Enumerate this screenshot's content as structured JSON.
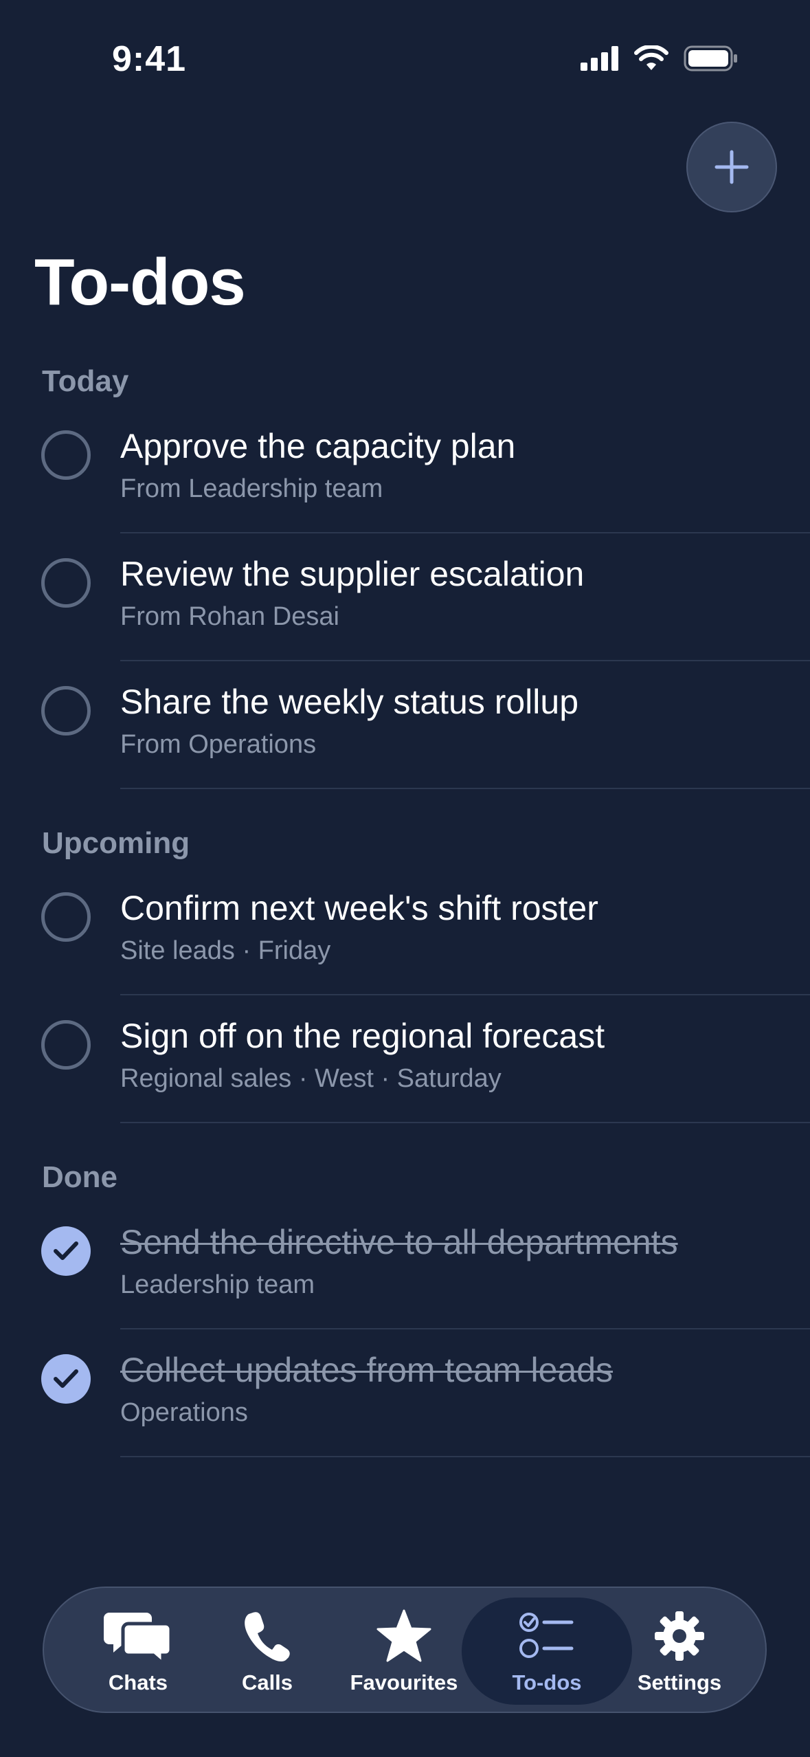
{
  "status_bar": {
    "time": "9:41",
    "icons": [
      "signal-icon",
      "wifi-icon",
      "battery-icon"
    ]
  },
  "header": {
    "add_button_icon": "plus-icon",
    "title": "To-dos"
  },
  "sections": {
    "today": {
      "label": "Today",
      "items": [
        {
          "title": "Approve the capacity plan",
          "subtitle": "From Leadership team",
          "done": false
        },
        {
          "title": "Review the supplier escalation",
          "subtitle": "From Rohan Desai",
          "done": false
        },
        {
          "title": "Share the weekly status rollup",
          "subtitle": "From Operations",
          "done": false
        }
      ]
    },
    "upcoming": {
      "label": "Upcoming",
      "items": [
        {
          "title": "Confirm next week's shift roster",
          "subtitle": "Site leads · Friday",
          "done": false
        },
        {
          "title": "Sign off on the regional forecast",
          "subtitle": "Regional sales · West · Saturday",
          "done": false
        }
      ]
    },
    "done": {
      "label": "Done",
      "items": [
        {
          "title": "Send the directive to all departments",
          "subtitle": "Leadership team",
          "done": true
        },
        {
          "title": "Collect updates from team leads",
          "subtitle": "Operations",
          "done": true
        }
      ]
    }
  },
  "tab_bar": {
    "tabs": [
      {
        "label": "Chats",
        "icon": "chat-bubbles-icon",
        "active": false
      },
      {
        "label": "Calls",
        "icon": "phone-icon",
        "active": false
      },
      {
        "label": "Favourites",
        "icon": "star-icon",
        "active": false
      },
      {
        "label": "To-dos",
        "icon": "checklist-icon",
        "active": true
      },
      {
        "label": "Settings",
        "icon": "gear-icon",
        "active": false
      }
    ]
  },
  "colors": {
    "background": "#162036",
    "accent": "#a4b9f0",
    "secondary_text": "#8c97ab",
    "tab_bar": "#2e3a54"
  }
}
